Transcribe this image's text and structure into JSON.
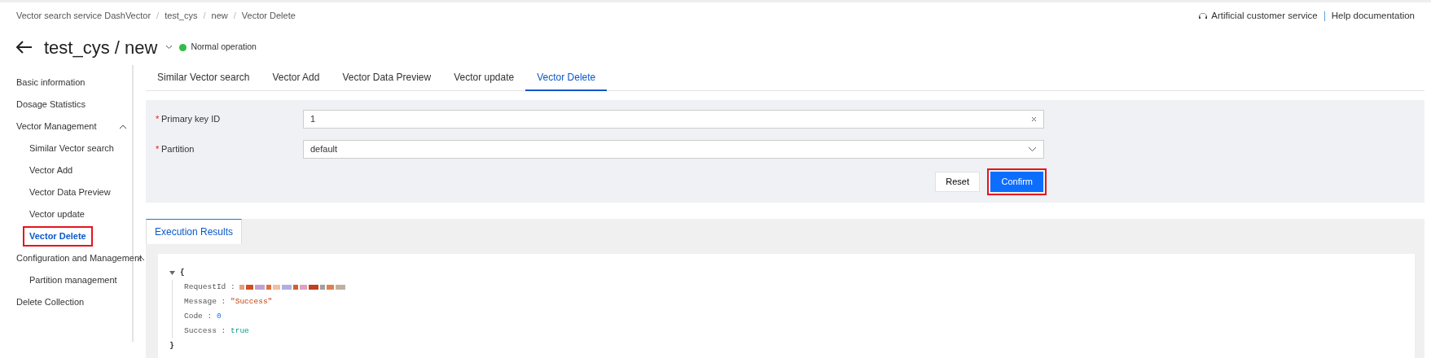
{
  "breadcrumb": [
    "Vector search service DashVector",
    "test_cys",
    "new",
    "Vector Delete"
  ],
  "breadcrumb_separator": "/",
  "header_links": [
    {
      "label": "Artificial customer service",
      "kind": "support"
    },
    {
      "label": "Help documentation",
      "kind": "plain"
    }
  ],
  "title": "test_cys / new",
  "status": {
    "label": "Normal operation",
    "color": "#2fbf45"
  },
  "sidebar": {
    "items": [
      {
        "label": "Basic information",
        "selected": false,
        "highlighted": false
      },
      {
        "label": "Dosage Statistics",
        "selected": false,
        "highlighted": false
      },
      {
        "label": "Vector Management",
        "expanded": true,
        "selected": false,
        "highlighted": false,
        "children": [
          {
            "label": "Similar Vector search",
            "selected": false,
            "highlighted": false
          },
          {
            "label": "Vector Add",
            "selected": false,
            "highlighted": false
          },
          {
            "label": "Vector Data Preview",
            "selected": false,
            "highlighted": false
          },
          {
            "label": "Vector update",
            "selected": false,
            "highlighted": false
          },
          {
            "label": "Vector Delete",
            "selected": true,
            "highlighted": true
          }
        ]
      },
      {
        "label": "Configuration and Management",
        "expanded": true,
        "selected": false,
        "highlighted": false,
        "children": [
          {
            "label": "Partition management",
            "selected": false,
            "highlighted": false
          }
        ]
      },
      {
        "label": "Delete Collection",
        "selected": false,
        "highlighted": false
      }
    ]
  },
  "tabs": [
    {
      "label": "Similar Vector search",
      "selected": false
    },
    {
      "label": "Vector Add",
      "selected": false
    },
    {
      "label": "Vector Data Preview",
      "selected": false
    },
    {
      "label": "Vector update",
      "selected": false
    },
    {
      "label": "Vector Delete",
      "selected": true
    }
  ],
  "form": {
    "fields": [
      {
        "label": "Primary key ID",
        "required_mark": "*",
        "kind": "text",
        "value": "1"
      },
      {
        "label": "Partition",
        "required_mark": "*",
        "kind": "select",
        "value": "default"
      }
    ],
    "buttons": [
      {
        "label": "Reset",
        "kind": "secondary",
        "highlighted": false
      },
      {
        "label": "Confirm",
        "kind": "primary",
        "highlighted": true
      }
    ]
  },
  "results": {
    "tab": "Execution Results",
    "open_brace": "{",
    "close_brace": "}",
    "separator": ":",
    "entries": [
      {
        "key": "RequestId",
        "kind": "redacted"
      },
      {
        "key": "Message",
        "kind": "string",
        "value": "\"Success\""
      },
      {
        "key": "Code",
        "kind": "number",
        "value": "0"
      },
      {
        "key": "Success",
        "kind": "boolean",
        "value": "true"
      }
    ]
  }
}
